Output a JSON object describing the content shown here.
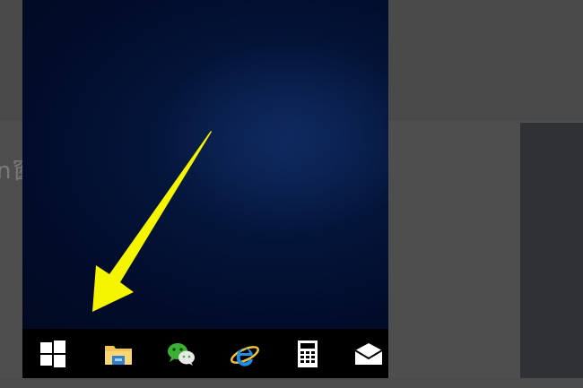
{
  "background": {
    "partial_text": "n窗"
  },
  "taskbar": {
    "items": [
      {
        "name": "start-button",
        "icon": "windows-logo-icon"
      },
      {
        "name": "file-explorer",
        "icon": "folder-icon"
      },
      {
        "name": "wechat",
        "icon": "wechat-icon"
      },
      {
        "name": "internet-explorer",
        "icon": "ie-icon"
      },
      {
        "name": "calculator",
        "icon": "calculator-icon"
      },
      {
        "name": "mail",
        "icon": "mail-icon"
      }
    ]
  },
  "annotation": {
    "arrow_color": "#f5f500"
  },
  "colors": {
    "desktop": "#020c2a",
    "taskbar": "#000000",
    "page_bg": "#4b4b4b"
  }
}
